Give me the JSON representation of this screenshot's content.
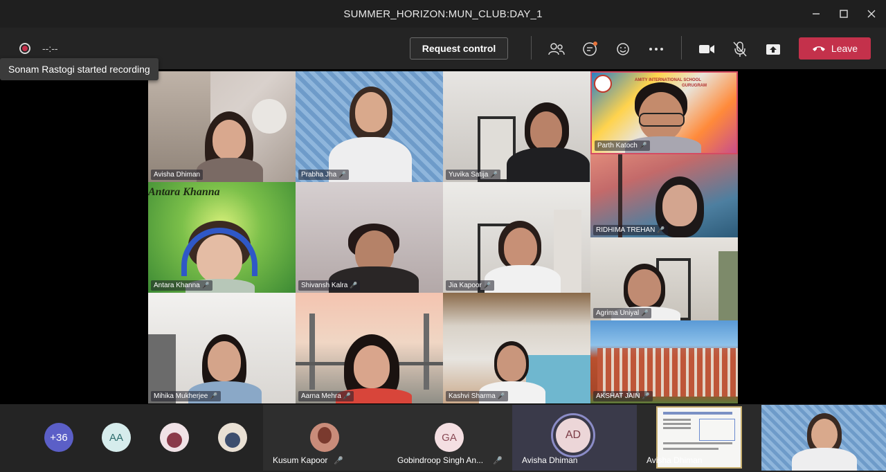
{
  "window": {
    "title": "SUMMER_HORIZON:MUN_CLUB:DAY_1",
    "minimize_icon": "minimize-icon",
    "maximize_icon": "maximize-icon",
    "close_icon": "close-icon"
  },
  "toolbar": {
    "recording_time": "--:--",
    "tooltip": "Sonam Rastogi started recording",
    "request_control": "Request control",
    "leave_label": "Leave",
    "leave_color": "#c4314b",
    "icons": [
      "participants-icon",
      "chat-icon",
      "reactions-icon",
      "more-icon",
      "camera-icon",
      "mic-off-icon",
      "share-icon"
    ]
  },
  "grid": {
    "tiles": [
      {
        "name": "Avisha Dhiman",
        "mic": ""
      },
      {
        "name": "Prabha Jha",
        "mic": "🎤"
      },
      {
        "name": "Yuvika Satija",
        "mic": "🎤"
      },
      {
        "name": "Parth Katoch",
        "mic": "🎤",
        "banner": "AMITY INTERNATIONAL SCHOOL",
        "banner2": "GURUGRAM"
      },
      {
        "name": "RIDHIMA TREHAN",
        "mic": "🎤"
      },
      {
        "name": "Antara Khanna",
        "mic": "🎤",
        "banner": "Antara Khanna"
      },
      {
        "name": "Shivansh Kalra",
        "mic": "🎤"
      },
      {
        "name": "Jia Kapoor",
        "mic": "🎤"
      },
      {
        "name": "Agrima Uniyal",
        "mic": "🎤"
      },
      {
        "name": "Mihika Mukherjee",
        "mic": "🎤"
      },
      {
        "name": "Aarna Mehra",
        "mic": "🎤"
      },
      {
        "name": "Kashvi Sharma",
        "mic": "🎤"
      },
      {
        "name": "AKSHAT JAIN",
        "mic": "🎤"
      }
    ]
  },
  "bottom": {
    "overflow_count": "+36",
    "avatars": [
      "AA"
    ],
    "strip": [
      {
        "name": "Kusum Kapoor",
        "mic": "🎤"
      },
      {
        "name": "Gobindroop Singh An...",
        "initials": "GA",
        "mic": "🎤"
      },
      {
        "name": "Avisha Dhiman",
        "initials": "AD"
      },
      {
        "name": "Avisha Dhiman"
      }
    ]
  }
}
